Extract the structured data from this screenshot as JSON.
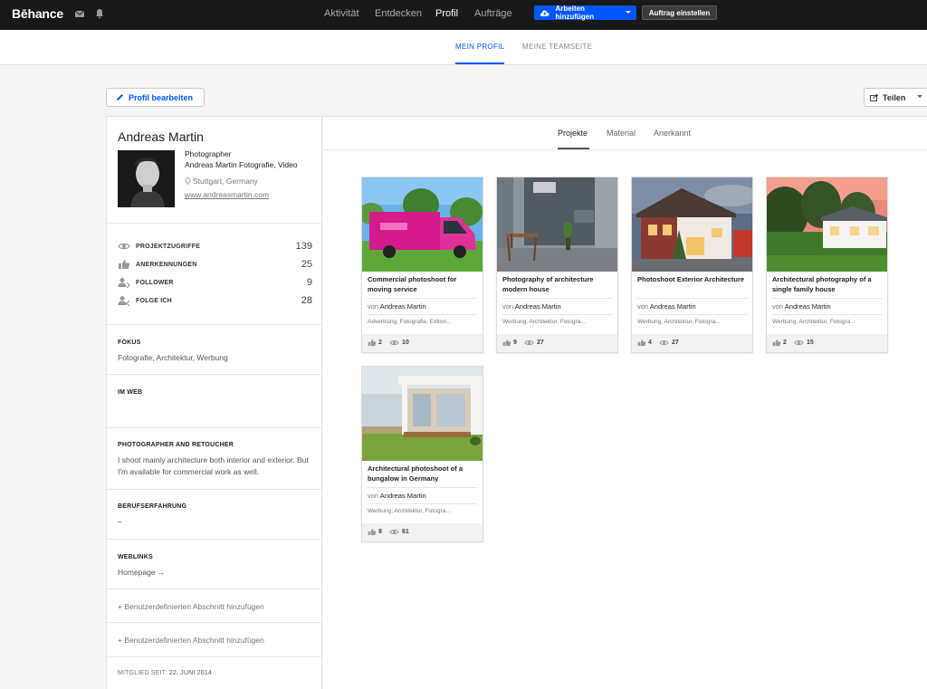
{
  "app": {
    "logo": "Bēhance",
    "top_nav": [
      "Aktivität",
      "Entdecken",
      "Profil",
      "Aufträge"
    ],
    "add_work_button": "Arbeiten hinzufügen",
    "post_job_button": "Auftrag einstellen"
  },
  "subnav": {
    "tabs": [
      "MEIN PROFIL",
      "MEINE TEAMSEITE"
    ]
  },
  "actions": {
    "edit_profile": "Profil bearbeiten",
    "share": "Teilen"
  },
  "profile": {
    "name": "Andreas Martin",
    "occupation": "Photographer",
    "company": "Andreas Martin Fotografie, Video",
    "location": "Stuttgart, Germany",
    "website": "www.andreasmartin.com",
    "stats": [
      {
        "label": "PROJEKTZUGRIFFE",
        "value": "139",
        "icon": "eye-icon"
      },
      {
        "label": "ANERKENNUNGEN",
        "value": "25",
        "icon": "thumbs-up-icon"
      },
      {
        "label": "FOLLOWER",
        "value": "9",
        "icon": "follower-icon"
      },
      {
        "label": "FOLGE ICH",
        "value": "28",
        "icon": "following-icon"
      }
    ],
    "sections": {
      "focus_heading": "FOKUS",
      "focus_text": "Fotografie, Architektur, Werbung",
      "web_heading": "IM WEB",
      "about_heading": "PHOTOGRAPHER AND RETOUCHER",
      "about_text": "I shoot mainly architecture both interior and exterior. But I'm available for commercial work as well.",
      "experience_heading": "BERUFSERFAHRUNG",
      "experience_text": "–",
      "weblinks_heading": "WEBLINKS",
      "weblinks_text": "Homepage →",
      "custom_section_1": "+ Benutzerdefinierten Abschnitt hinzufügen",
      "custom_section_2": "+ Benutzerdefinierten Abschnitt hinzufügen",
      "member_since_label": "MITGLIED SEIT:",
      "member_since_date": "22. JUNI 2014"
    }
  },
  "main_tabs": [
    "Projekte",
    "Material",
    "Anerkannt"
  ],
  "projects": [
    {
      "title": "Commercial photoshoot for moving service",
      "by": "von",
      "author": "Andreas Martin",
      "tags": "Advertising, Fotografie, Editori...",
      "likes": "2",
      "views": "10"
    },
    {
      "title": "Photography of architecture modern house",
      "by": "von",
      "author": "Andreas Martin",
      "tags": "Werbung, Architektur, Fotogra...",
      "likes": "9",
      "views": "27"
    },
    {
      "title": "Photoshoot Exterior Architecture",
      "by": "von",
      "author": "Andreas Martin",
      "tags": "Werbung, Architektur, Fotogra...",
      "likes": "4",
      "views": "27"
    },
    {
      "title": "Architectural photography of a single family house",
      "by": "von",
      "author": "Andreas Martin",
      "tags": "Werbung, Architektur, Fotogra...",
      "likes": "2",
      "views": "15"
    },
    {
      "title": "Architectural photoshoot of a bungalow in Germany",
      "by": "von",
      "author": "Andreas Martin",
      "tags": "Werbung, Architektur, Fotogra...",
      "likes": "8",
      "views": "61"
    }
  ],
  "colors": {
    "accent": "#0057ff",
    "topbar": "#191919"
  }
}
